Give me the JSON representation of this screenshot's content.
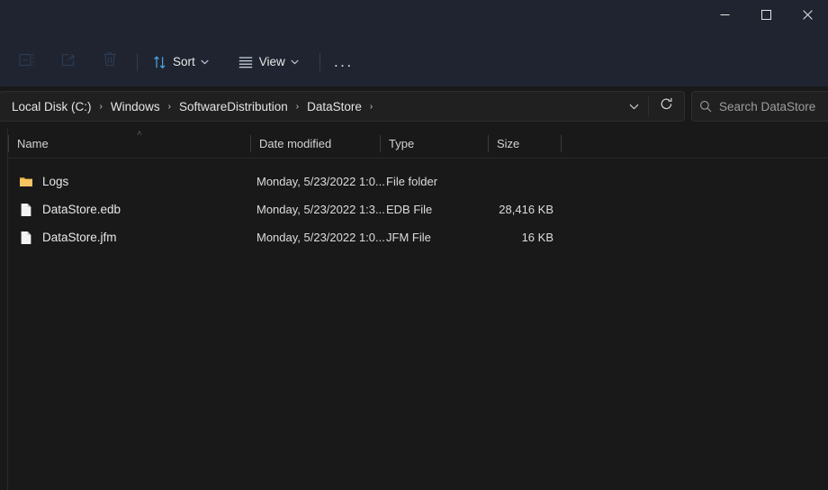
{
  "window": {
    "controls": [
      {
        "name": "minimize-button",
        "icon": "minimize-icon",
        "label": "Minimize"
      },
      {
        "name": "maximize-button",
        "icon": "maximize-icon",
        "label": "Maximize"
      },
      {
        "name": "close-button",
        "icon": "close-icon",
        "label": "Close"
      }
    ]
  },
  "toolbar": {
    "rename_icon": "rename-icon",
    "share_icon": "share-icon",
    "delete_icon": "delete-icon",
    "sort_label": "Sort",
    "view_label": "View",
    "more_label": "...",
    "sort_icon": "sort-arrows-icon",
    "view_icon": "list-lines-icon",
    "chevron_icon": "chevron-down-icon"
  },
  "address": {
    "breadcrumbs": [
      {
        "label": "Local Disk  (C:)"
      },
      {
        "label": "Windows"
      },
      {
        "label": "SoftwareDistribution"
      },
      {
        "label": "DataStore"
      }
    ],
    "separator": "›",
    "history_icon": "chevron-down-icon",
    "refresh_icon": "refresh-icon"
  },
  "search": {
    "placeholder": "Search DataStore",
    "icon": "search-icon",
    "value": ""
  },
  "columns": [
    {
      "key": "name",
      "label": "Name",
      "sorted": "asc",
      "sort_glyph": "˄"
    },
    {
      "key": "date",
      "label": "Date modified"
    },
    {
      "key": "type",
      "label": "Type"
    },
    {
      "key": "size",
      "label": "Size"
    }
  ],
  "files": [
    {
      "name": "Logs",
      "icon": "folder-icon",
      "date": "Monday, 5/23/2022 1:0...",
      "type": "File folder",
      "size": ""
    },
    {
      "name": "DataStore.edb",
      "icon": "file-icon",
      "date": "Monday, 5/23/2022 1:3...",
      "type": "EDB File",
      "size": "28,416 KB"
    },
    {
      "name": "DataStore.jfm",
      "icon": "file-icon",
      "date": "Monday, 5/23/2022 1:0...",
      "type": "JFM File",
      "size": "16 KB"
    }
  ],
  "colors": {
    "titlebar_bg": "#1f2430",
    "content_bg": "#191919",
    "folder": "#f7c562",
    "accent": "#4aa3df"
  }
}
